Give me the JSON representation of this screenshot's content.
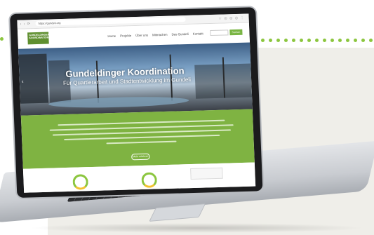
{
  "browser": {
    "url": "https://gundeli.org",
    "nav_glyphs": "‹ › ⟳",
    "ext_glyphs": "☆ ◎ ◎ ◎ ⋮"
  },
  "site": {
    "logo_line1": "GUNDELDINGER",
    "logo_line2": "KOORDINATION",
    "menu": [
      "Home",
      "Projekte",
      "Über uns",
      "Mitmachen",
      "Das Gundeli",
      "Kontakt"
    ],
    "search_button": "Suchen",
    "hero_title": "Gundeldinger Koordination",
    "hero_subtitle": "Für Quartierarbeit und Stadtentwicklung im Gundeli",
    "more_button": "Mehr erfahren",
    "accent": "#7fb342",
    "badge_accent": "#f2c230"
  },
  "icons": {
    "prev_slide": "chevron-left-icon"
  }
}
